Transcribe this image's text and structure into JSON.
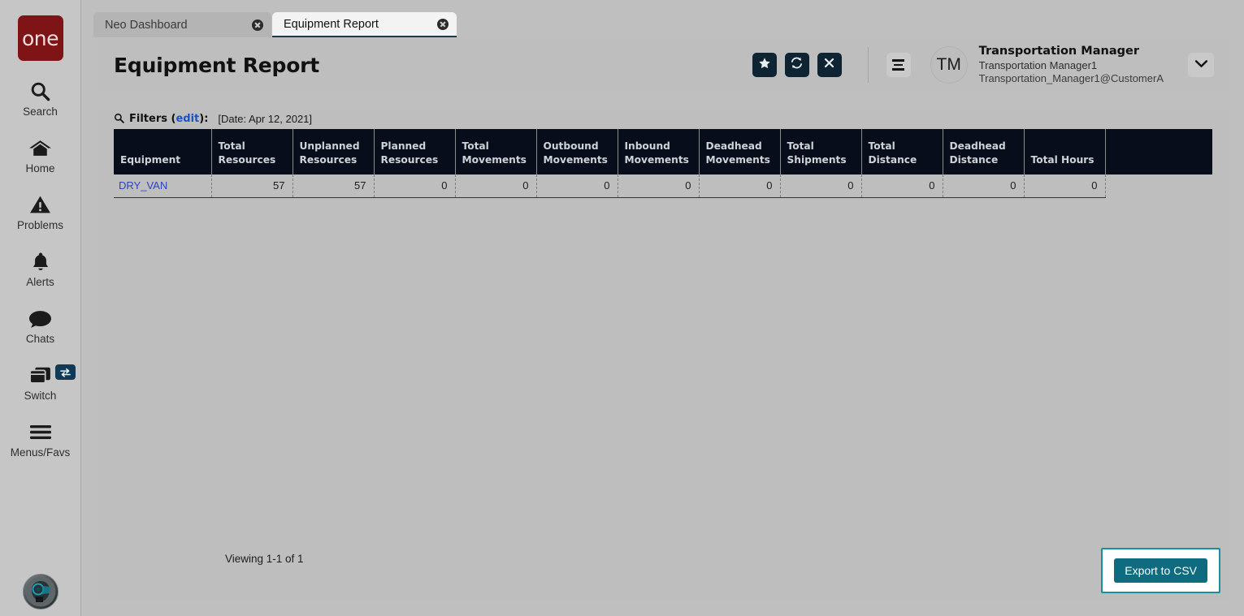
{
  "app": {
    "logo_text": "one",
    "brand_color": "#7e1416",
    "accent_navy": "#0e2433",
    "accent_teal": "#0e6b80",
    "link_color": "#2a44c4"
  },
  "sidebar": {
    "items": [
      {
        "label": "Search",
        "icon": "search-icon"
      },
      {
        "label": "Home",
        "icon": "home-icon"
      },
      {
        "label": "Problems",
        "icon": "warning-triangle-icon"
      },
      {
        "label": "Alerts",
        "icon": "bell-icon"
      },
      {
        "label": "Chats",
        "icon": "chat-bubble-icon"
      },
      {
        "label": "Switch",
        "icon": "windows-stack-icon",
        "badge_icon": "swap-arrows-icon"
      },
      {
        "label": "Menus/Favs",
        "icon": "hamburger-icon"
      }
    ],
    "bot_avatar_icon": "ai-assistant-avatar-icon"
  },
  "tabs": [
    {
      "label": "Neo Dashboard",
      "active": false,
      "close_icon": "close-circle-icon"
    },
    {
      "label": "Equipment Report",
      "active": true,
      "close_icon": "close-circle-icon"
    }
  ],
  "header": {
    "title": "Equipment Report",
    "actions": [
      {
        "name": "favorite-button",
        "icon": "star-icon"
      },
      {
        "name": "refresh-button",
        "icon": "refresh-icon"
      },
      {
        "name": "close-button",
        "icon": "x-icon"
      }
    ],
    "menu_icon": "hamburger-icon",
    "avatar_initials": "TM",
    "user_role": "Transportation Manager",
    "user_name": "Transportation Manager1",
    "user_email": "Transportation_Manager1@CustomerA",
    "caret_icon": "chevron-down-icon"
  },
  "filters": {
    "icon": "search-icon",
    "label": "Filters (",
    "edit_label": "edit",
    "label_close": "):",
    "date_text": "[Date: Apr 12, 2021]"
  },
  "table": {
    "columns": [
      "Equipment",
      "Total Resources",
      "Unplanned Resources",
      "Planned Resources",
      "Total Movements",
      "Outbound Movements",
      "Inbound Movements",
      "Deadhead Movements",
      "Total Shipments",
      "Total Distance",
      "Deadhead Distance",
      "Total Hours"
    ],
    "rows": [
      {
        "equipment": "DRY_VAN",
        "total_resources": "57",
        "unplanned_resources": "57",
        "planned_resources": "0",
        "total_movements": "0",
        "outbound_movements": "0",
        "inbound_movements": "0",
        "deadhead_movements": "0",
        "total_shipments": "0",
        "total_distance": "0",
        "deadhead_distance": "0",
        "total_hours": "0"
      }
    ]
  },
  "footer": {
    "viewing_text": "Viewing 1-1 of 1",
    "export_label": "Export to CSV"
  }
}
